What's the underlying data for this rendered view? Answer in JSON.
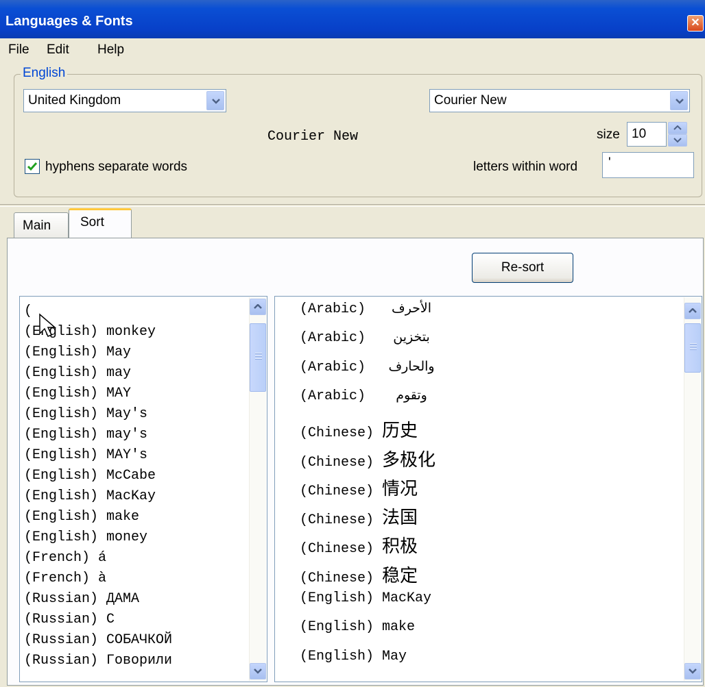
{
  "window": {
    "title": "Languages & Fonts",
    "close_glyph": "✕"
  },
  "menu": {
    "file": "File",
    "edit": "Edit",
    "help": "Help"
  },
  "language_group": {
    "legend": "English",
    "region": "United Kingdom",
    "font": "Courier New",
    "font_preview": "Courier New",
    "size_label": "size",
    "size_value": "10",
    "hyphens_label": "hyphens separate words",
    "hyphens_checked": true,
    "letters_label": "letters within word",
    "letters_value": "'"
  },
  "tabs": {
    "main": "Main",
    "sort": "Sort",
    "active": "Sort"
  },
  "sort_panel": {
    "resort_label": "Re-sort",
    "left_list": [
      "(",
      "(English) monkey",
      "(English) May",
      "(English) may",
      "(English) MAY",
      "(English) May's",
      "(English) may's",
      "(English) MAY's",
      "(English) McCabe",
      "(English) MacKay",
      "(English) make",
      "(English) money",
      "(French) á",
      "(French) à",
      "(Russian) ДАМА",
      "(Russian) С",
      "(Russian) СОБАЧКОЙ",
      "(Russian) Говорили"
    ],
    "right_list": [
      {
        "lang": "(Arabic)",
        "word": "الأحرف",
        "script": "arab"
      },
      {
        "lang": "(Arabic)",
        "word": "بتخزين",
        "script": "arab"
      },
      {
        "lang": "(Arabic)",
        "word": "والحارف",
        "script": "arab"
      },
      {
        "lang": "(Arabic)",
        "word": "وتقوم",
        "script": "arab"
      },
      {
        "lang": "(Chinese)",
        "word": "历史",
        "script": "cjk"
      },
      {
        "lang": "(Chinese)",
        "word": "多极化",
        "script": "cjk"
      },
      {
        "lang": "(Chinese)",
        "word": "情况",
        "script": "cjk"
      },
      {
        "lang": "(Chinese)",
        "word": "法国",
        "script": "cjk"
      },
      {
        "lang": "(Chinese)",
        "word": "积极",
        "script": "cjk"
      },
      {
        "lang": "(Chinese)",
        "word": "稳定",
        "script": "cjk"
      },
      {
        "lang": "(English)",
        "word": "MacKay",
        "script": "latin"
      },
      {
        "lang": "(English)",
        "word": "make",
        "script": "latin"
      },
      {
        "lang": "(English)",
        "word": "May",
        "script": "latin"
      }
    ]
  },
  "colors": {
    "title_bar": "#0a4fd4",
    "legend": "#0046d5",
    "tab_highlight": "#ffc83c"
  }
}
